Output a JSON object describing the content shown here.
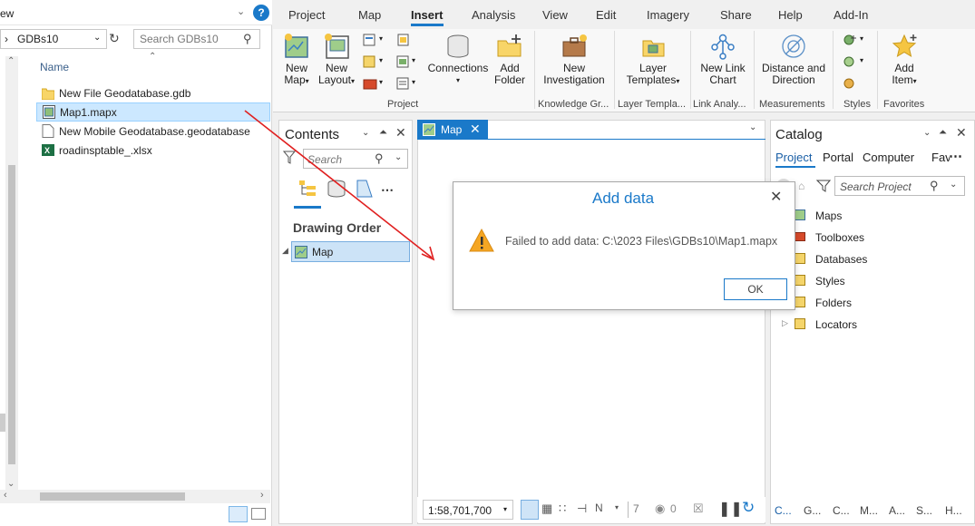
{
  "explorer": {
    "view_fragment": "ew",
    "address": "GDBs10",
    "search_placeholder": "Search GDBs10",
    "column_name": "Name",
    "files": [
      {
        "name": "New File Geodatabase.gdb",
        "icon": "folder-icon",
        "selected": false
      },
      {
        "name": "Map1.mapx",
        "icon": "map-file-icon",
        "selected": true
      },
      {
        "name": "New Mobile Geodatabase.geodatabase",
        "icon": "file-icon",
        "selected": false
      },
      {
        "name": "roadinsptable_.xlsx",
        "icon": "excel-icon",
        "selected": false
      }
    ]
  },
  "ribbon": {
    "tabs": [
      "Project",
      "Map",
      "Insert",
      "Analysis",
      "View",
      "Edit",
      "Imagery",
      "Share",
      "Help",
      "Add-In"
    ],
    "active_tab": "Insert",
    "buttons": {
      "new_map": [
        "New",
        "Map"
      ],
      "new_layout": [
        "New",
        "Layout"
      ],
      "connections": "Connections",
      "add_folder": [
        "Add",
        "Folder"
      ],
      "new_investigation": [
        "New",
        "Investigation"
      ],
      "layer_templates": [
        "Layer",
        "Templates"
      ],
      "new_link_chart": [
        "New Link",
        "Chart"
      ],
      "distance_direction": [
        "Distance and",
        "Direction"
      ],
      "add_item": [
        "Add",
        "Item"
      ]
    },
    "groups": [
      "Project",
      "Knowledge Gr...",
      "Layer Templa...",
      "Link Analy...",
      "Measurements",
      "Styles",
      "Favorites"
    ]
  },
  "contents": {
    "title": "Contents",
    "search_placeholder": "Search",
    "drawing_order": "Drawing Order",
    "layer": "Map"
  },
  "map_view": {
    "tab_label": "Map",
    "scale": "1:58,701,700",
    "selected_count": "7",
    "zero": "0"
  },
  "dialog": {
    "title": "Add data",
    "message": "Failed to add data: C:\\2023 Files\\GDBs10\\Map1.mapx",
    "ok": "OK"
  },
  "catalog": {
    "title": "Catalog",
    "tabs": [
      "Project",
      "Portal",
      "Computer",
      "Fav"
    ],
    "search_placeholder": "Search Project",
    "items": [
      "Maps",
      "Toolboxes",
      "Databases",
      "Styles",
      "Folders",
      "Locators"
    ],
    "bottom_tabs": [
      "C...",
      "G...",
      "C...",
      "M...",
      "A...",
      "S...",
      "H..."
    ]
  },
  "colors": {
    "accent": "#1a79c9",
    "selection": "#cce8ff",
    "arrow": "#e02020",
    "warning": "#f5a623"
  }
}
